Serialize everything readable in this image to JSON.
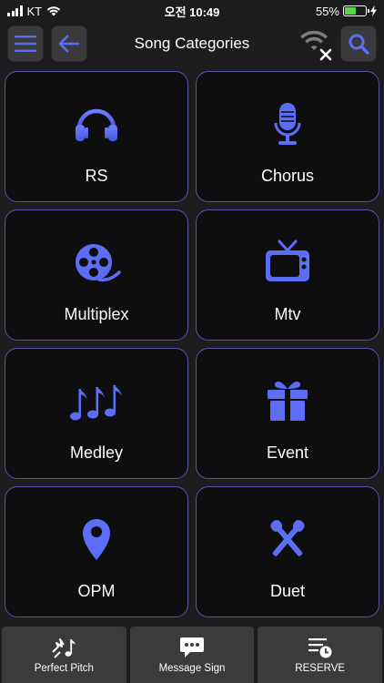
{
  "status_bar": {
    "carrier": "KT",
    "time": "오전 10:49",
    "battery_text": "55%",
    "battery_level": 0.55,
    "battery_color": "#5ad649"
  },
  "nav": {
    "title": "Song Categories",
    "menu_icon": "hamburger-menu-icon",
    "back_icon": "back-arrow-icon",
    "wifi_icon": "wifi-off-icon",
    "search_icon": "search-icon"
  },
  "colors": {
    "accent": "#5b6ef5",
    "tile_border": "#5656a8",
    "tile_bg": "#0e0e10",
    "page_bg": "#1c1c1e"
  },
  "categories": [
    {
      "label": "RS",
      "icon": "headphones-icon"
    },
    {
      "label": "Chorus",
      "icon": "microphone-icon"
    },
    {
      "label": "Multiplex",
      "icon": "film-reel-icon"
    },
    {
      "label": "Mtv",
      "icon": "tv-icon"
    },
    {
      "label": "Medley",
      "icon": "music-notes-icon"
    },
    {
      "label": "Event",
      "icon": "gift-icon"
    },
    {
      "label": "OPM",
      "icon": "map-pin-icon"
    },
    {
      "label": "Duet",
      "icon": "crossed-microphones-icon"
    }
  ],
  "bottom_bar": [
    {
      "label": "Perfect Pitch",
      "icon": "perfect-pitch-icon"
    },
    {
      "label": "Message Sign",
      "icon": "message-bubble-icon"
    },
    {
      "label": "RESERVE",
      "icon": "reserve-list-icon"
    }
  ]
}
